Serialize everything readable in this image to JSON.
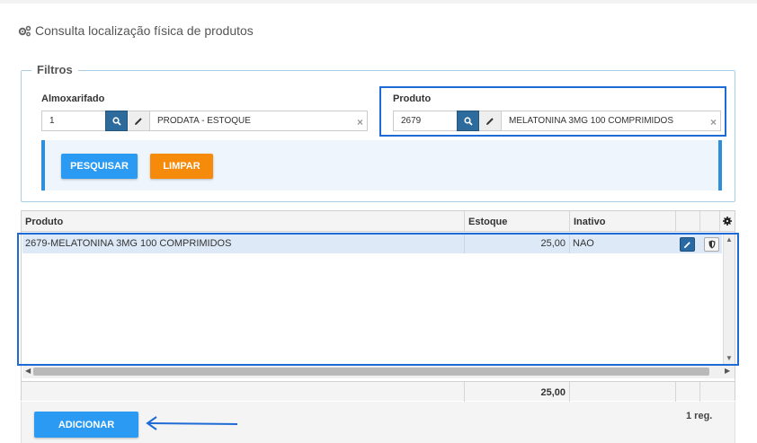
{
  "page": {
    "title": "Consulta localização física de produtos",
    "title_icon": "gears-icon"
  },
  "filters": {
    "legend": "Filtros",
    "almoxarifado": {
      "label": "Almoxarifado",
      "code": "1",
      "description": "PRODATA - ESTOQUE"
    },
    "produto": {
      "label": "Produto",
      "code": "2679",
      "description": "MELATONINA 3MG 100 COMPRIMIDOS"
    },
    "buttons": {
      "pesquisar": "PESQUISAR",
      "limpar": "LIMPAR"
    }
  },
  "grid": {
    "columns": [
      "Produto",
      "Estoque",
      "Inativo"
    ],
    "rows": [
      {
        "produto": "2679-MELATONINA 3MG 100 COMPRIMIDOS",
        "estoque": "25,00",
        "inativo": "NAO"
      }
    ],
    "footer_total": "25,00"
  },
  "footer": {
    "adicionar": "ADICIONAR",
    "reg_count": "1 reg."
  },
  "colors": {
    "primary_button": "#2b9af3",
    "warning_button": "#f68a0b",
    "highlight": "#1e6bd6",
    "search_button": "#2d6b9d"
  }
}
